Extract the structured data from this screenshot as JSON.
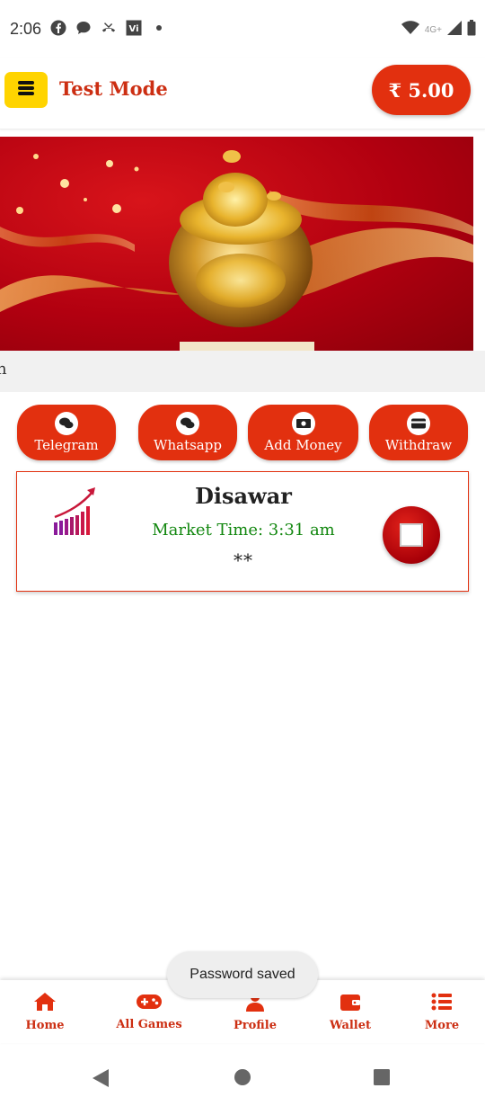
{
  "status_bar": {
    "time": "2:06",
    "icons": [
      "facebook-icon",
      "chat-bubble-icon",
      "missed-call-icon",
      "vi-icon",
      "dot-icon"
    ],
    "network_label": "4G+",
    "right_icons": [
      "wifi-icon",
      "signal-icon",
      "battery-icon"
    ]
  },
  "app_bar": {
    "title": "Test Mode",
    "balance": "₹ 5.00",
    "menu_icon": "hamburger-menu-icon"
  },
  "notice": {
    "text": "n"
  },
  "actions": [
    {
      "label": "Telegram",
      "icon": "chat-icon"
    },
    {
      "label": "Whatsapp",
      "icon": "chat-icon"
    },
    {
      "label": "Add Money",
      "icon": "money-icon"
    },
    {
      "label": "Withdraw",
      "icon": "card-icon"
    }
  ],
  "market": {
    "name": "Disawar",
    "time": "Market Time: 3:31 am",
    "result": "**",
    "status_icon": "stop-icon"
  },
  "toast": "Password saved",
  "bottom_nav": [
    {
      "label": "Home",
      "icon": "home-icon"
    },
    {
      "label": "All Games",
      "icon": "gamepad-icon"
    },
    {
      "label": "Profile",
      "icon": "user-icon"
    },
    {
      "label": "Wallet",
      "icon": "wallet-icon"
    },
    {
      "label": "More",
      "icon": "list-icon"
    }
  ],
  "colors": {
    "accent": "#e2300f",
    "title": "#cc2e12",
    "menu_button": "#ffd400",
    "market_time": "#12870f"
  }
}
